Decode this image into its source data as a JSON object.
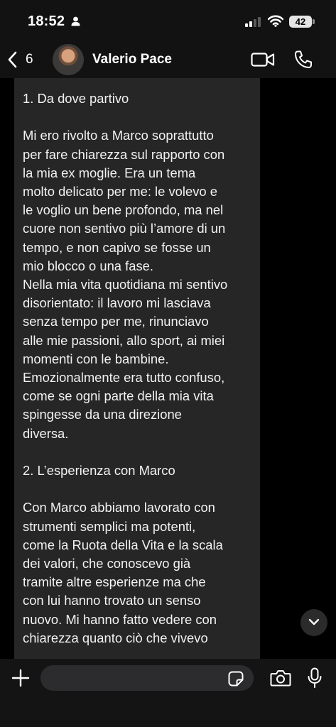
{
  "status_bar": {
    "time": "18:52",
    "battery": "42"
  },
  "header": {
    "back_count": "6",
    "contact_name": "Valerio Pace"
  },
  "message": {
    "text": "1. Da dove partivo\n\nMi ero rivolto a Marco soprattutto\nper fare chiarezza sul rapporto con\nla mia ex moglie. Era un tema\nmolto delicato per me: le volevo e\nle voglio un bene profondo, ma nel\ncuore non sentivo più l’amore di un\ntempo, e non capivo se fosse un\nmio blocco o una fase.\nNella mia vita quotidiana mi sentivo\ndisorientato: il lavoro mi lasciava\nsenza tempo per me, rinunciavo\nalle mie passioni, allo sport, ai miei\nmomenti con le bambine.\nEmozionalmente era tutto confuso,\ncome se ogni parte della mia vita\nspingesse da una direzione\ndiversa.\n\n2. L’esperienza con Marco\n\nCon Marco abbiamo lavorato con\nstrumenti semplici ma potenti,\ncome la Ruota della Vita e la scala\ndei valori, che conoscevo già\ntramite altre esperienze ma che\ncon lui hanno trovato un senso\nnuovo. Mi hanno fatto vedere con\nchiarezza quanto ciò che vivevo"
  },
  "input": {
    "value": "",
    "placeholder": ""
  },
  "icons": {
    "back": "chevron-left-icon",
    "video": "video-camera-icon",
    "call": "phone-icon",
    "attach": "plus-icon",
    "sticker": "sticker-icon",
    "camera": "camera-icon",
    "mic": "microphone-icon",
    "scroll": "chevron-down-icon"
  },
  "colors": {
    "background": "#000000",
    "bubble": "#262626",
    "text": "#f2f2f2"
  }
}
